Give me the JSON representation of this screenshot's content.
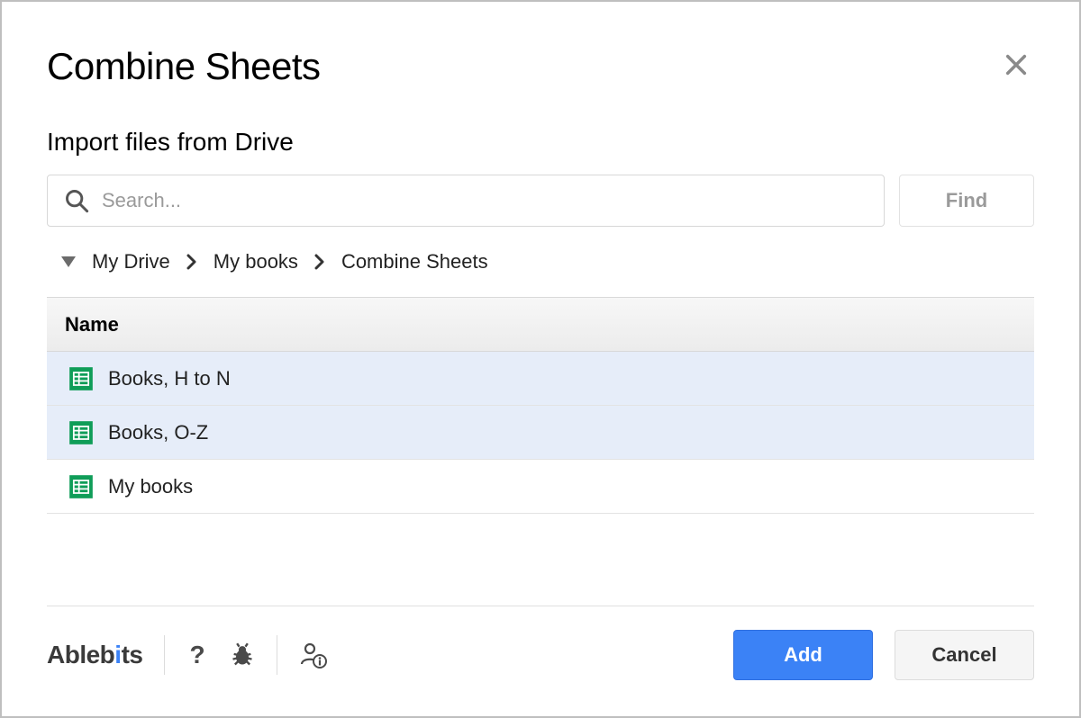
{
  "title": "Combine Sheets",
  "subtitle": "Import files from Drive",
  "search": {
    "placeholder": "Search..."
  },
  "buttons": {
    "find": "Find",
    "add": "Add",
    "cancel": "Cancel"
  },
  "breadcrumb": {
    "items": [
      "My Drive",
      "My books",
      "Combine Sheets"
    ]
  },
  "table": {
    "header": "Name",
    "rows": [
      {
        "name": "Books, H to N",
        "selected": true
      },
      {
        "name": "Books, O-Z",
        "selected": true
      },
      {
        "name": "My books",
        "selected": false
      }
    ]
  },
  "brand": "Ablebits"
}
